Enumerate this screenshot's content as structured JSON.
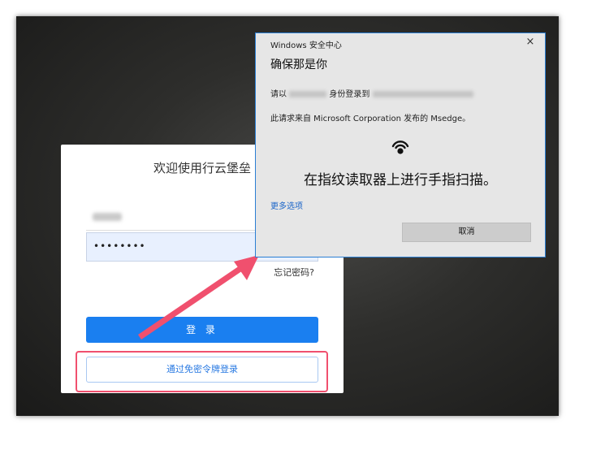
{
  "login": {
    "title": "欢迎使用行云堡垒",
    "password_value": "••••••••",
    "forgot_password": "忘记密码?",
    "login_button": "登 录",
    "token_login_button": "通过免密令牌登录"
  },
  "dialog": {
    "app_title": "Windows 安全中心",
    "close_symbol": "×",
    "heading": "确保那是你",
    "login_prefix": "请以",
    "login_mid": "身份登录到",
    "request_line": "此请求来自 Microsoft Corporation 发布的 Msedge。",
    "prompt": "在指纹读取器上进行手指扫描。",
    "more_options": "更多选项",
    "cancel_button": "取消"
  },
  "icons": {
    "fingerprint": "fingerprint-icon",
    "close": "close-icon",
    "arrow": "annotation-arrow"
  },
  "colors": {
    "primary_blue": "#1a7ff0",
    "annotation_red": "#f0506e",
    "dialog_border": "#2b7fd4",
    "link_blue": "#1a64c8"
  }
}
